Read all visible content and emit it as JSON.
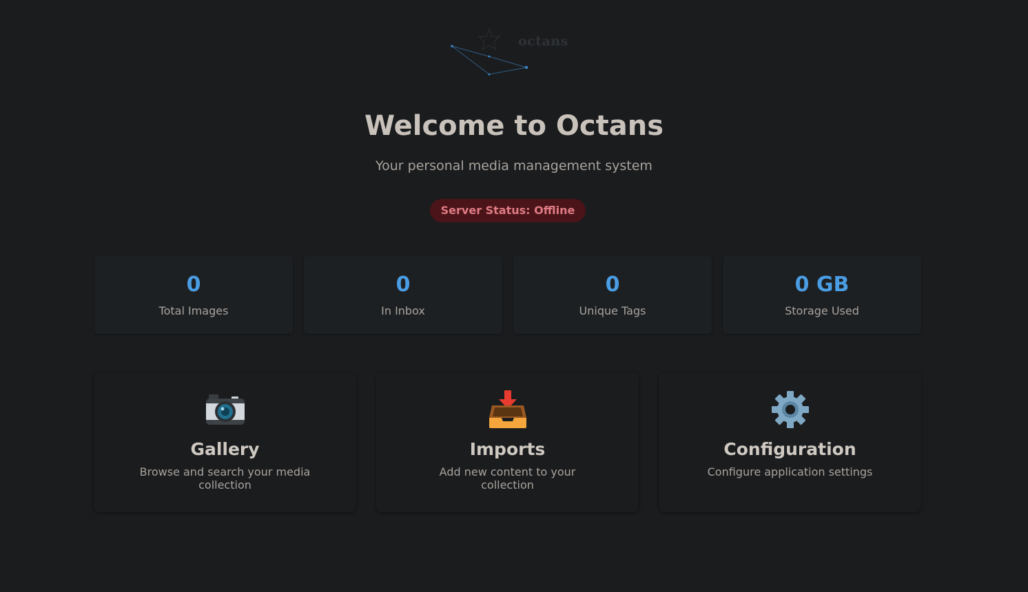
{
  "logo": {
    "text": "octans",
    "icon": "constellation-star-icon"
  },
  "hero": {
    "title": "Welcome to Octans",
    "subtitle": "Your personal media management system"
  },
  "status": {
    "text": "Server Status: Offline",
    "color": "#e07b84",
    "background": "#4a1418"
  },
  "stats": [
    {
      "value": "0",
      "label": "Total Images"
    },
    {
      "value": "0",
      "label": "In Inbox"
    },
    {
      "value": "0",
      "label": "Unique Tags"
    },
    {
      "value": "0 GB",
      "label": "Storage Used"
    }
  ],
  "cards": [
    {
      "icon": "camera-icon",
      "title": "Gallery",
      "description": "Browse and search your media collection"
    },
    {
      "icon": "inbox-tray-icon",
      "title": "Imports",
      "description": "Add new content to your collection"
    },
    {
      "icon": "gear-icon",
      "title": "Configuration",
      "description": "Configure application settings"
    }
  ],
  "colors": {
    "background": "#1b1c1e",
    "accent": "#4a9de3"
  }
}
